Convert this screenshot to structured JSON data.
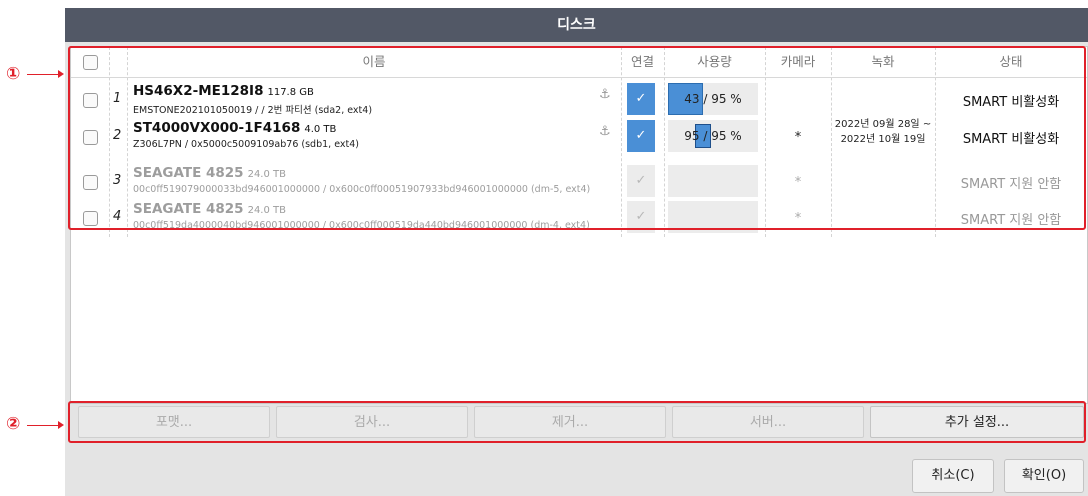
{
  "dialog": {
    "title": "디스크"
  },
  "table": {
    "headers": {
      "name": "이름",
      "connect": "연결",
      "usage": "사용량",
      "camera": "카메라",
      "recording": "녹화",
      "status": "상태"
    },
    "rows": [
      {
        "index": "1",
        "model": "HS46X2-ME128I8",
        "size": "117.8 GB",
        "detail": "EMSTONE202101050019 /  / 2번 파티션 (sda2, ext4)",
        "connected": "✓",
        "usage_text": "43 / 95 %",
        "usage_percent": 43,
        "camera": "",
        "recording": "",
        "status": "SMART 비활성화"
      },
      {
        "index": "2",
        "model": "ST4000VX000-1F4168",
        "size": "4.0 TB",
        "detail": "Z306L7PN / 0x5000c5009109ab76 (sdb1, ext4)",
        "connected": "✓",
        "usage_text": "95 / 95 %",
        "usage_percent": 95,
        "camera": "*",
        "recording": "",
        "status": "SMART 비활성화"
      },
      {
        "index": "3",
        "model": "SEAGATE 4825",
        "size": "24.0 TB",
        "detail": "00c0ff519079000033bd946001000000 / 0x600c0ff00051907933bd946001000000 (dm-5, ext4)",
        "connected": "✓",
        "usage_text": "",
        "camera": "*",
        "recording": "",
        "status": "SMART 지원 안함"
      },
      {
        "index": "4",
        "model": "SEAGATE 4825",
        "size": "24.0 TB",
        "detail": "00c0ff519da4000040bd946001000000 / 0x600c0ff000519da440bd946001000000 (dm-4, ext4)",
        "connected": "✓",
        "usage_text": "",
        "camera": "*",
        "recording": "",
        "status": "SMART 지원 안함"
      }
    ],
    "recording_range": {
      "line1": "2022년 09월 28일 ~",
      "line2": "2022년 10월 19일"
    }
  },
  "actions": {
    "format": "포맷...",
    "check": "검사...",
    "remove": "제거...",
    "server": "서버...",
    "more_settings": "추가 설정..."
  },
  "footer": {
    "cancel": "취소(C)",
    "ok": "확인(O)"
  },
  "callouts": {
    "one": "①",
    "two": "②"
  },
  "colors": {
    "accent": "#4a8fd6",
    "annotation": "#e0202a",
    "titlebar": "#525866"
  }
}
